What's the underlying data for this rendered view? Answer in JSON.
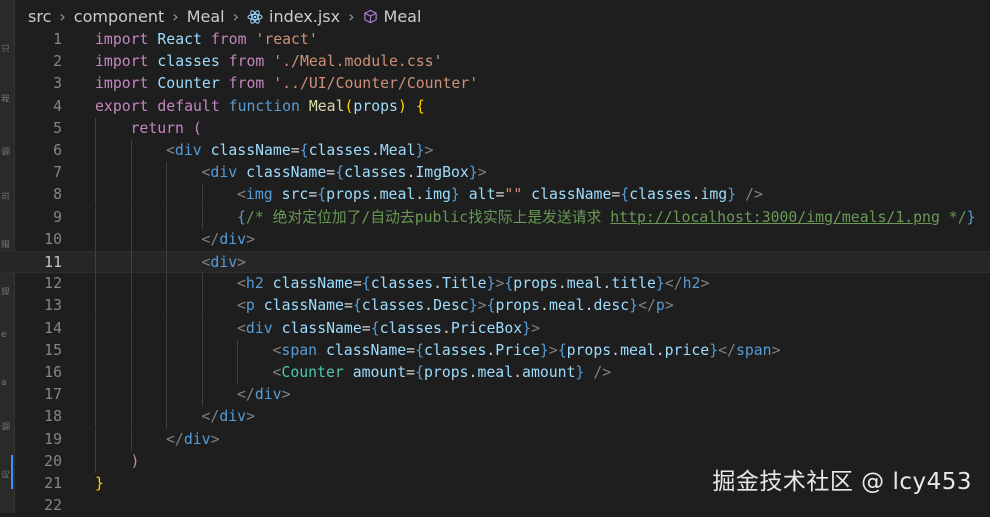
{
  "breadcrumb": {
    "parts": [
      "src",
      "component",
      "Meal",
      "index.jsx",
      "Meal"
    ],
    "icons": [
      "react-icon",
      "cube-icon"
    ]
  },
  "editor": {
    "active_line": 11,
    "lines": [
      {
        "n": "1",
        "indent": 0,
        "tokens": [
          [
            "kw",
            "import"
          ],
          [
            "t",
            " "
          ],
          [
            "var",
            "React"
          ],
          [
            "t",
            " "
          ],
          [
            "kw",
            "from"
          ],
          [
            "t",
            " "
          ],
          [
            "str",
            "'react'"
          ]
        ]
      },
      {
        "n": "2",
        "indent": 0,
        "tokens": [
          [
            "kw",
            "import"
          ],
          [
            "t",
            " "
          ],
          [
            "var",
            "classes"
          ],
          [
            "t",
            " "
          ],
          [
            "kw",
            "from"
          ],
          [
            "t",
            " "
          ],
          [
            "str",
            "'./Meal.module.css'"
          ]
        ]
      },
      {
        "n": "3",
        "indent": 0,
        "tokens": [
          [
            "kw",
            "import"
          ],
          [
            "t",
            " "
          ],
          [
            "var",
            "Counter"
          ],
          [
            "t",
            " "
          ],
          [
            "kw",
            "from"
          ],
          [
            "t",
            " "
          ],
          [
            "str",
            "'../UI/Counter/Counter'"
          ]
        ]
      },
      {
        "n": "4",
        "indent": 0,
        "tokens": [
          [
            "kw",
            "export"
          ],
          [
            "t",
            " "
          ],
          [
            "kw",
            "default"
          ],
          [
            "t",
            " "
          ],
          [
            "k2",
            "function"
          ],
          [
            "t",
            " "
          ],
          [
            "fn",
            "Meal"
          ],
          [
            "brk",
            "("
          ],
          [
            "var",
            "props"
          ],
          [
            "brk",
            ")"
          ],
          [
            "t",
            " "
          ],
          [
            "brk",
            "{"
          ]
        ]
      },
      {
        "n": "5",
        "indent": 1,
        "tokens": [
          [
            "kw",
            "return"
          ],
          [
            "t",
            " "
          ],
          [
            "kw",
            "("
          ]
        ]
      },
      {
        "n": "6",
        "indent": 2,
        "tokens": [
          [
            "punc",
            "<"
          ],
          [
            "tag",
            "div"
          ],
          [
            "t",
            " "
          ],
          [
            "var",
            "className"
          ],
          [
            "t",
            "="
          ],
          [
            "k2",
            "{"
          ],
          [
            "var",
            "classes"
          ],
          [
            "t",
            "."
          ],
          [
            "var",
            "Meal"
          ],
          [
            "k2",
            "}"
          ],
          [
            "punc",
            ">"
          ]
        ]
      },
      {
        "n": "7",
        "indent": 3,
        "tokens": [
          [
            "punc",
            "<"
          ],
          [
            "tag",
            "div"
          ],
          [
            "t",
            " "
          ],
          [
            "var",
            "className"
          ],
          [
            "t",
            "="
          ],
          [
            "k2",
            "{"
          ],
          [
            "var",
            "classes"
          ],
          [
            "t",
            "."
          ],
          [
            "var",
            "ImgBox"
          ],
          [
            "k2",
            "}"
          ],
          [
            "punc",
            ">"
          ]
        ]
      },
      {
        "n": "8",
        "indent": 4,
        "tokens": [
          [
            "punc",
            "<"
          ],
          [
            "tag",
            "img"
          ],
          [
            "t",
            " "
          ],
          [
            "var",
            "src"
          ],
          [
            "t",
            "="
          ],
          [
            "k2",
            "{"
          ],
          [
            "var",
            "props"
          ],
          [
            "t",
            "."
          ],
          [
            "var",
            "meal"
          ],
          [
            "t",
            "."
          ],
          [
            "var",
            "img"
          ],
          [
            "k2",
            "}"
          ],
          [
            "t",
            " "
          ],
          [
            "var",
            "alt"
          ],
          [
            "t",
            "="
          ],
          [
            "str",
            "\"\""
          ],
          [
            "t",
            " "
          ],
          [
            "var",
            "className"
          ],
          [
            "t",
            "="
          ],
          [
            "k2",
            "{"
          ],
          [
            "var",
            "classes"
          ],
          [
            "t",
            "."
          ],
          [
            "var",
            "img"
          ],
          [
            "k2",
            "}"
          ],
          [
            "t",
            " "
          ],
          [
            "punc",
            "/>"
          ]
        ]
      },
      {
        "n": "9",
        "indent": 4,
        "tokens": [
          [
            "k2",
            "{"
          ],
          [
            "cmt",
            "/* 绝对定位加了/自动去public找实际上是发送请求 "
          ],
          [
            "cmt",
            "http://localhost:3000/img/meals/1.png"
          ],
          [
            "cmt",
            " */"
          ],
          [
            "k2",
            "}"
          ]
        ]
      },
      {
        "n": "10",
        "indent": 3,
        "tokens": [
          [
            "punc",
            "</"
          ],
          [
            "tag",
            "div"
          ],
          [
            "punc",
            ">"
          ]
        ]
      },
      {
        "n": "11",
        "indent": 3,
        "tokens": [
          [
            "punc",
            "<"
          ],
          [
            "tag",
            "div"
          ],
          [
            "punc",
            ">"
          ]
        ]
      },
      {
        "n": "12",
        "indent": 4,
        "tokens": [
          [
            "punc",
            "<"
          ],
          [
            "tag",
            "h2"
          ],
          [
            "t",
            " "
          ],
          [
            "var",
            "className"
          ],
          [
            "t",
            "="
          ],
          [
            "k2",
            "{"
          ],
          [
            "var",
            "classes"
          ],
          [
            "t",
            "."
          ],
          [
            "var",
            "Title"
          ],
          [
            "k2",
            "}"
          ],
          [
            "punc",
            ">"
          ],
          [
            "k2",
            "{"
          ],
          [
            "var",
            "props"
          ],
          [
            "t",
            "."
          ],
          [
            "var",
            "meal"
          ],
          [
            "t",
            "."
          ],
          [
            "var",
            "title"
          ],
          [
            "k2",
            "}"
          ],
          [
            "punc",
            "</"
          ],
          [
            "tag",
            "h2"
          ],
          [
            "punc",
            ">"
          ]
        ]
      },
      {
        "n": "13",
        "indent": 4,
        "tokens": [
          [
            "punc",
            "<"
          ],
          [
            "tag",
            "p"
          ],
          [
            "t",
            " "
          ],
          [
            "var",
            "className"
          ],
          [
            "t",
            "="
          ],
          [
            "k2",
            "{"
          ],
          [
            "var",
            "classes"
          ],
          [
            "t",
            "."
          ],
          [
            "var",
            "Desc"
          ],
          [
            "k2",
            "}"
          ],
          [
            "punc",
            ">"
          ],
          [
            "k2",
            "{"
          ],
          [
            "var",
            "props"
          ],
          [
            "t",
            "."
          ],
          [
            "var",
            "meal"
          ],
          [
            "t",
            "."
          ],
          [
            "var",
            "desc"
          ],
          [
            "k2",
            "}"
          ],
          [
            "punc",
            "</"
          ],
          [
            "tag",
            "p"
          ],
          [
            "punc",
            ">"
          ]
        ]
      },
      {
        "n": "14",
        "indent": 4,
        "tokens": [
          [
            "punc",
            "<"
          ],
          [
            "tag",
            "div"
          ],
          [
            "t",
            " "
          ],
          [
            "var",
            "className"
          ],
          [
            "t",
            "="
          ],
          [
            "k2",
            "{"
          ],
          [
            "var",
            "classes"
          ],
          [
            "t",
            "."
          ],
          [
            "var",
            "PriceBox"
          ],
          [
            "k2",
            "}"
          ],
          [
            "punc",
            ">"
          ]
        ]
      },
      {
        "n": "15",
        "indent": 5,
        "tokens": [
          [
            "punc",
            "<"
          ],
          [
            "tag",
            "span"
          ],
          [
            "t",
            " "
          ],
          [
            "var",
            "className"
          ],
          [
            "t",
            "="
          ],
          [
            "k2",
            "{"
          ],
          [
            "var",
            "classes"
          ],
          [
            "t",
            "."
          ],
          [
            "var",
            "Price"
          ],
          [
            "k2",
            "}"
          ],
          [
            "punc",
            ">"
          ],
          [
            "k2",
            "{"
          ],
          [
            "var",
            "props"
          ],
          [
            "t",
            "."
          ],
          [
            "var",
            "meal"
          ],
          [
            "t",
            "."
          ],
          [
            "var",
            "price"
          ],
          [
            "k2",
            "}"
          ],
          [
            "punc",
            "</"
          ],
          [
            "tag",
            "span"
          ],
          [
            "punc",
            ">"
          ]
        ]
      },
      {
        "n": "16",
        "indent": 5,
        "tokens": [
          [
            "punc",
            "<"
          ],
          [
            "comp",
            "Counter"
          ],
          [
            "t",
            " "
          ],
          [
            "var",
            "amount"
          ],
          [
            "t",
            "="
          ],
          [
            "k2",
            "{"
          ],
          [
            "var",
            "props"
          ],
          [
            "t",
            "."
          ],
          [
            "var",
            "meal"
          ],
          [
            "t",
            "."
          ],
          [
            "var",
            "amount"
          ],
          [
            "k2",
            "}"
          ],
          [
            "t",
            " "
          ],
          [
            "punc",
            "/>"
          ]
        ]
      },
      {
        "n": "17",
        "indent": 4,
        "tokens": [
          [
            "punc",
            "</"
          ],
          [
            "tag",
            "div"
          ],
          [
            "punc",
            ">"
          ]
        ]
      },
      {
        "n": "18",
        "indent": 3,
        "tokens": [
          [
            "punc",
            "</"
          ],
          [
            "tag",
            "div"
          ],
          [
            "punc",
            ">"
          ]
        ]
      },
      {
        "n": "19",
        "indent": 2,
        "tokens": [
          [
            "punc",
            "</"
          ],
          [
            "tag",
            "div"
          ],
          [
            "punc",
            ">"
          ]
        ]
      },
      {
        "n": "20",
        "indent": 1,
        "tokens": [
          [
            "kw",
            ")"
          ]
        ]
      },
      {
        "n": "21",
        "indent": 0,
        "tokens": [
          [
            "brk",
            "}"
          ]
        ]
      },
      {
        "n": "22",
        "indent": 0,
        "tokens": []
      }
    ]
  },
  "watermark": "掘金技术社区 @ lcy453"
}
